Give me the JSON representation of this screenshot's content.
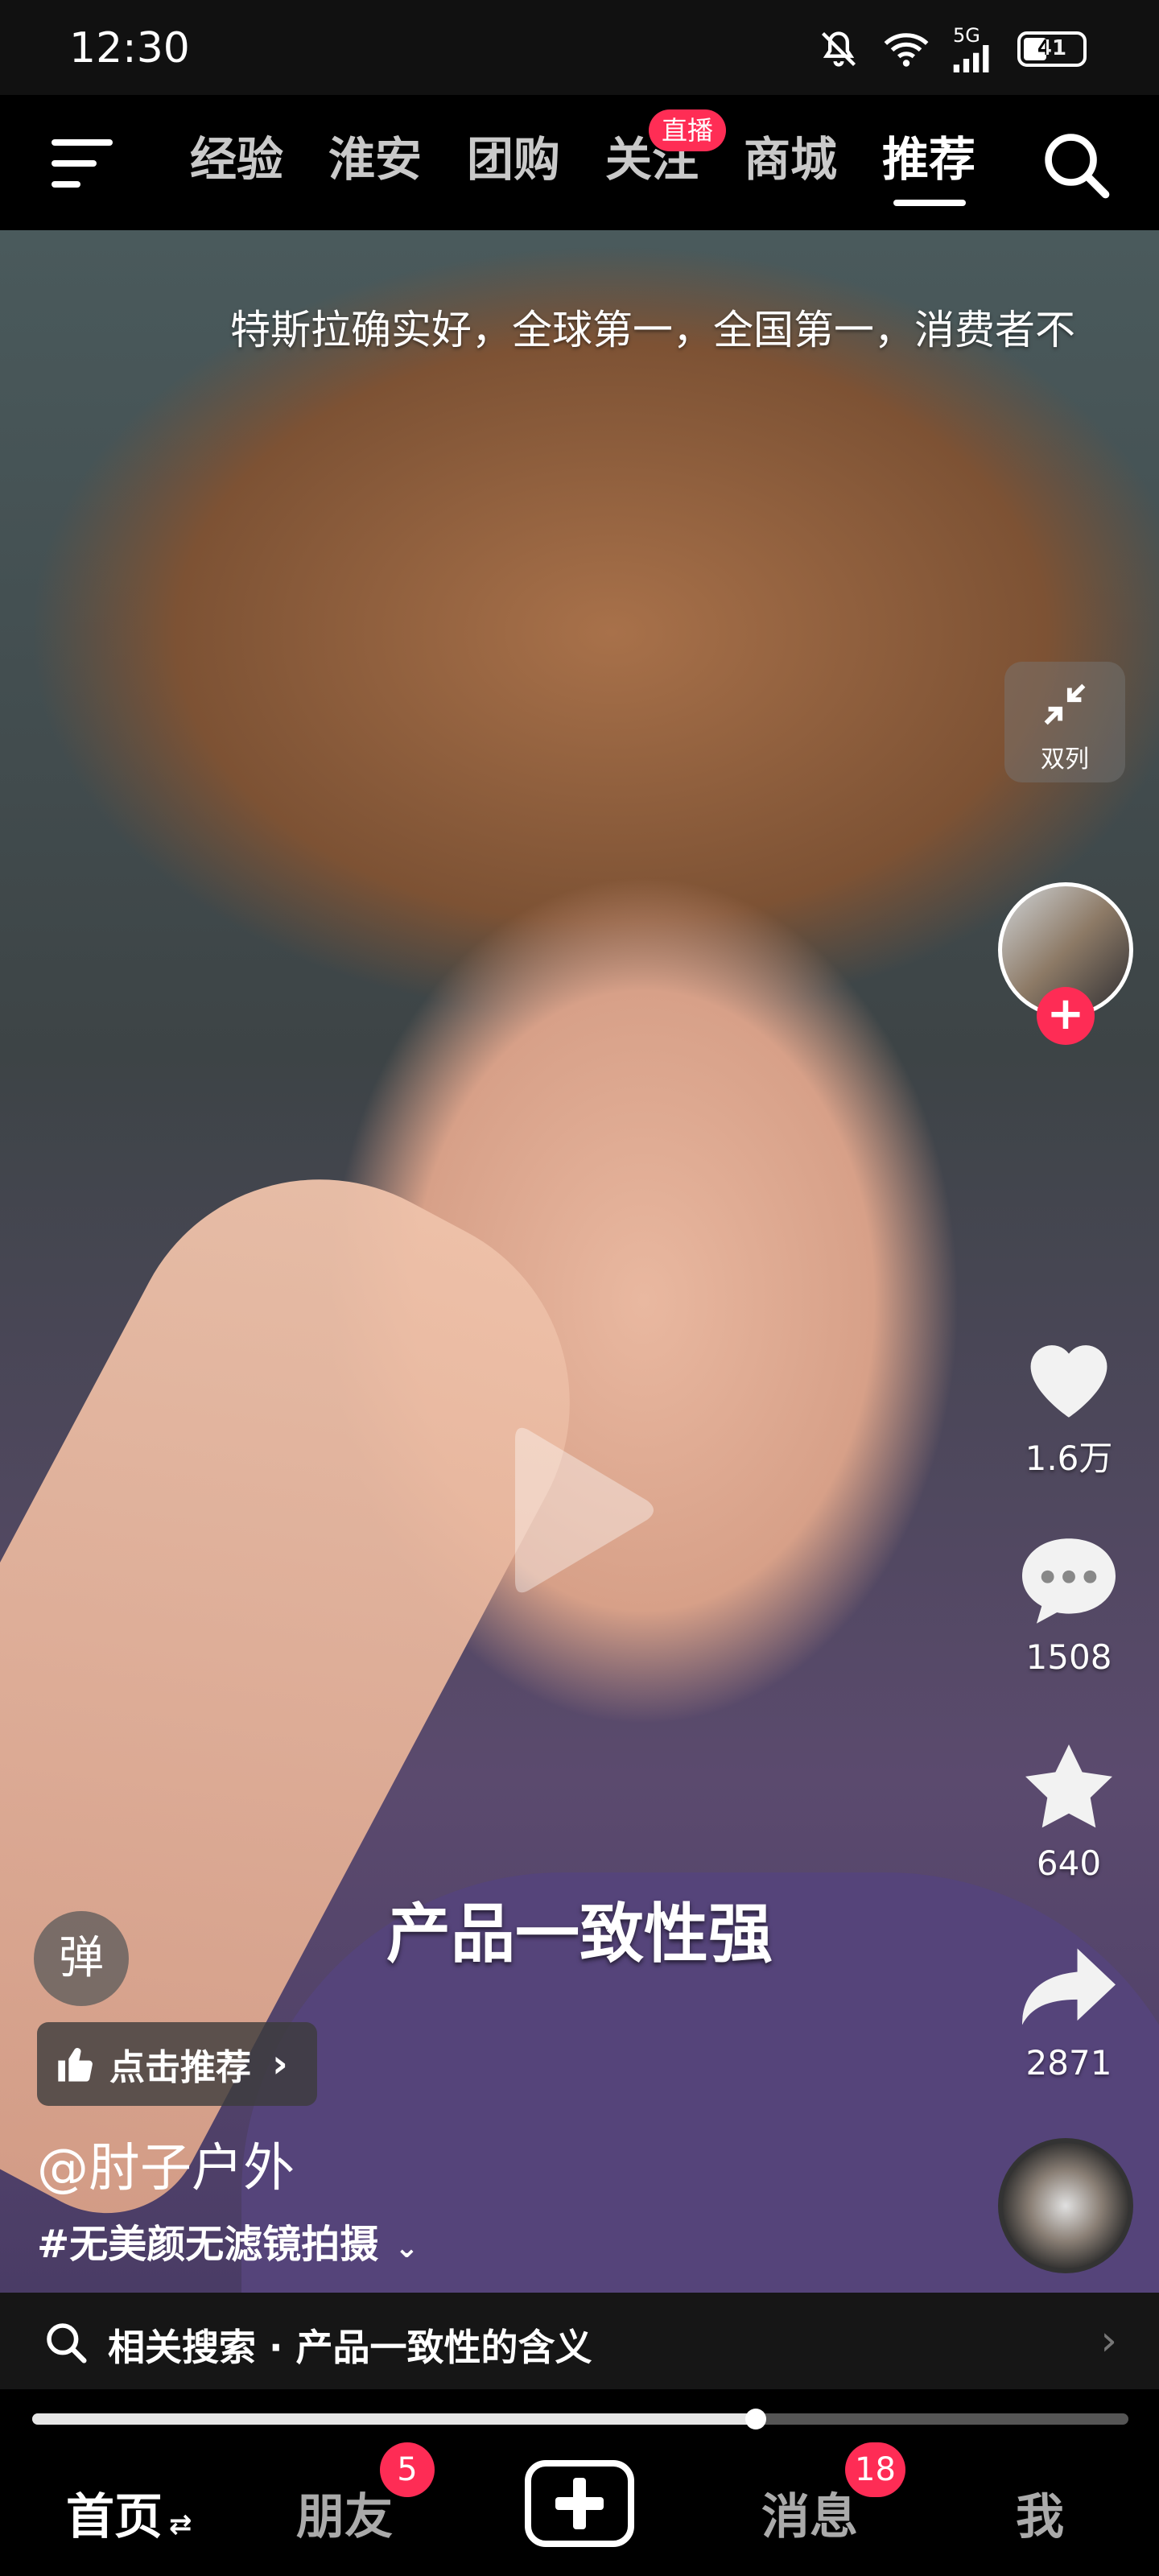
{
  "status_bar": {
    "time": "12:30",
    "network": "5G",
    "battery": "41"
  },
  "top_nav": {
    "tabs": [
      {
        "label": "经验"
      },
      {
        "label": "淮安"
      },
      {
        "label": "团购"
      },
      {
        "label": "关注",
        "badge": "直播"
      },
      {
        "label": "商城"
      },
      {
        "label": "推荐",
        "active": true
      }
    ]
  },
  "video": {
    "danmaku": "特斯拉确实好，全球第一，全国第一，消费者不",
    "subtitle": "产品一致性强",
    "danmaku_toggle": "弹",
    "recommend_label": "点击推荐",
    "author": "@肘子户外",
    "hashtag": "#无美颜无滤镜拍摄"
  },
  "actions": {
    "dual_column_label": "双列",
    "likes": "1.6万",
    "comments": "1508",
    "favorites": "640",
    "shares": "2871"
  },
  "related_search": {
    "label": "相关搜索 · 产品一致性的含义"
  },
  "playback": {
    "progress": 0.66
  },
  "bottom_nav": {
    "home": "首页",
    "friends": "朋友",
    "friends_badge": "5",
    "messages": "消息",
    "messages_badge": "18",
    "me": "我"
  },
  "colors": {
    "accent": "#fe2c55",
    "background": "#000000"
  }
}
